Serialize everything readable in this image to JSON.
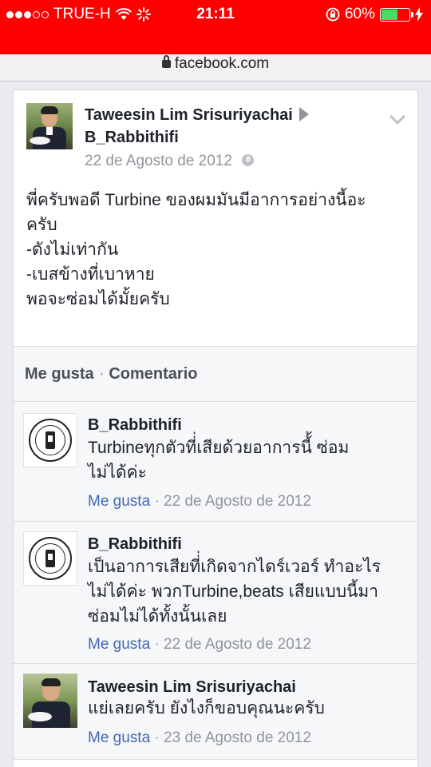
{
  "status_bar": {
    "carrier": "TRUE-H",
    "time": "21:11",
    "battery": "60%",
    "battery_level": 0.6,
    "signal_bars_filled": 3,
    "signal_bars_total": 5
  },
  "url_bar": {
    "domain": "facebook.com"
  },
  "post": {
    "author": "Taweesin Lim Srisuriyachai",
    "target": "B_Rabbithifi",
    "date": "22 de Agosto de 2012",
    "text_lines": [
      "พี่ครับพอดี Turbine ของผมมันมีอาการอย่างนี้อะ",
      "ครับ",
      "-ดังไม่เท่ากัน",
      "-เบสข้างที่เบาหาย",
      "พอจะซ่อมได้มั้ยครับ"
    ],
    "actions": {
      "like": "Me gusta",
      "separator": "·",
      "comment": "Comentario"
    }
  },
  "comments": [
    {
      "author": "B_Rabbithifi",
      "text_lines": [
        "Turbineทุกตัวที่่เสียด้วยอาการนี้้ ซ่อม",
        "ไม่ได้ค่ะ"
      ],
      "like": "Me gusta",
      "date": "· 22 de Agosto de 2012"
    },
    {
      "author": "B_Rabbithifi",
      "text_lines": [
        "เป็นอาการเสียที่่เกิดจากไดร์เวอร์ ทำอะไร",
        "ไม่ได้ค่ะ พวกTurbine,beats เสียแบบนี้มา",
        "ซ่อมไม่ได้ทั้งนั้นเลย"
      ],
      "like": "Me gusta",
      "date": "· 22 de Agosto de 2012"
    },
    {
      "author": "Taweesin Lim Srisuriyachai",
      "text_lines": [
        "แย่เลยครับ ยังไงก็ขอบคุณนะครับ"
      ],
      "like": "Me gusta",
      "date": "· 23 de Agosto de 2012"
    }
  ],
  "colors": {
    "status_bar_bg": "#ff0000",
    "link_blue": "#4267b2",
    "meta_gray": "#90949c",
    "battery_green": "#4cd964"
  },
  "icons": [
    "signal-dots-icon",
    "wifi-icon",
    "activity-spinner-icon",
    "rotation-lock-icon",
    "battery-icon",
    "charging-icon",
    "lock-icon",
    "expand-chevron-icon",
    "audience-globe-icon",
    "share-arrow-icon"
  ]
}
